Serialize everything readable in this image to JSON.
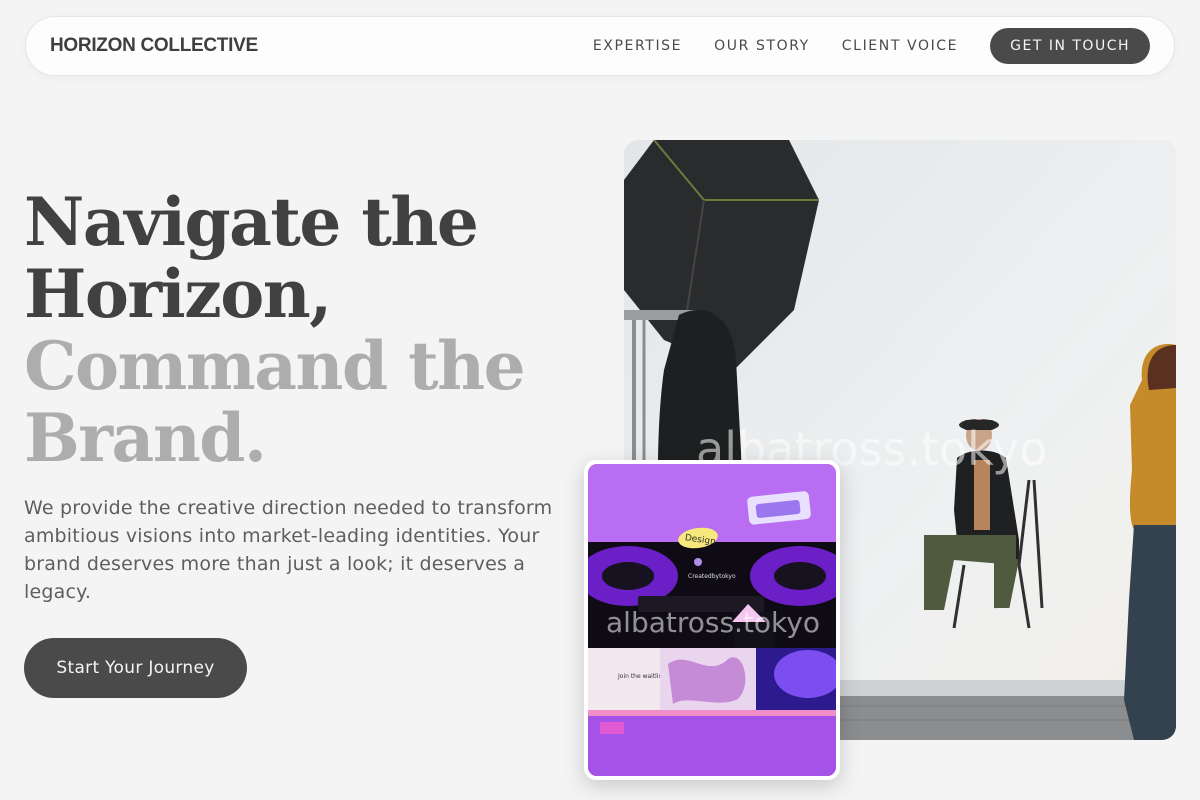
{
  "nav": {
    "brand": "HORIZON COLLECTIVE",
    "links": [
      "EXPERTISE",
      "OUR STORY",
      "CLIENT VOICE"
    ],
    "cta": "GET IN TOUCH"
  },
  "hero": {
    "headline_dark_1": "Navigate the",
    "headline_dark_2": "Horizon,",
    "headline_light_1": "Command the",
    "headline_light_2": "Brand.",
    "subtitle": "We provide the creative direction needed to transform ambitious visions into market-leading identities. Your brand deserves more than just a look; it deserves a legacy.",
    "button": "Start Your Journey"
  },
  "watermark": "albatross.tokyo",
  "card": {
    "sticker": "Design",
    "app_name": "Createdbytokyo",
    "waitlist": "Join the waitlist"
  },
  "colors": {
    "background": "#f4f4f4",
    "button_dark": "#4a4a4a",
    "headline_dark": "#414141",
    "headline_light": "#adadad",
    "card_purple": "#b66af0"
  }
}
